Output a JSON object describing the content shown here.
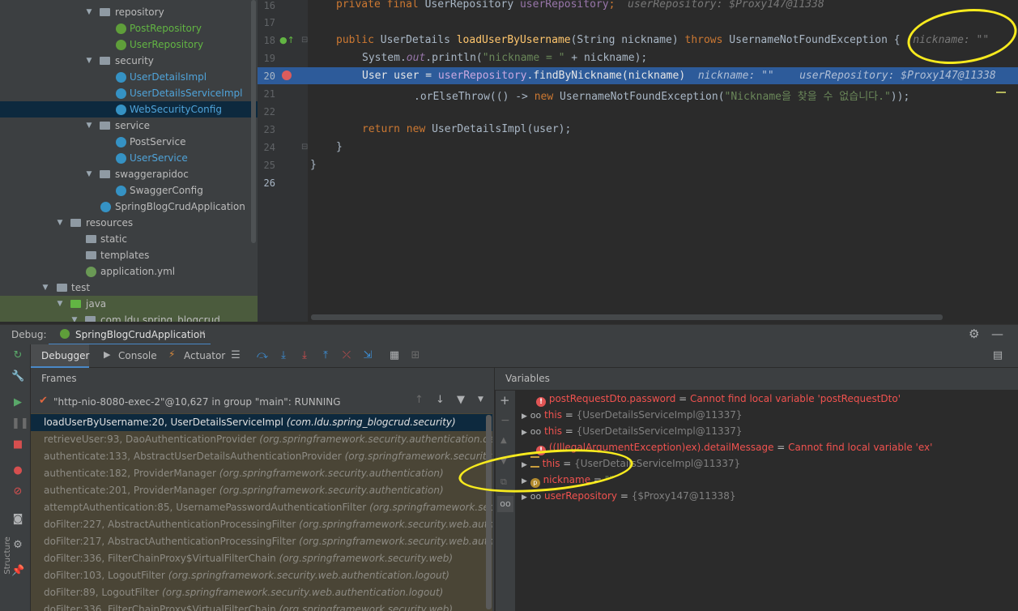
{
  "project_tree": {
    "items": [
      {
        "label": "repository",
        "kind": "folder",
        "expanded": true
      },
      {
        "label": "PostRepository",
        "kind": "interface"
      },
      {
        "label": "UserRepository",
        "kind": "interface"
      },
      {
        "label": "security",
        "kind": "folder",
        "expanded": true
      },
      {
        "label": "UserDetailsImpl",
        "kind": "class"
      },
      {
        "label": "UserDetailsServiceImpl",
        "kind": "class"
      },
      {
        "label": "WebSecurityConfig",
        "kind": "class"
      },
      {
        "label": "service",
        "kind": "folder",
        "expanded": true
      },
      {
        "label": "PostService",
        "kind": "class"
      },
      {
        "label": "UserService",
        "kind": "class"
      },
      {
        "label": "swaggerapidoc",
        "kind": "folder",
        "expanded": true
      },
      {
        "label": "SwaggerConfig",
        "kind": "class"
      },
      {
        "label": "SpringBlogCrudApplication",
        "kind": "app"
      },
      {
        "label": "resources",
        "kind": "folder",
        "expanded": true
      },
      {
        "label": "static",
        "kind": "folder"
      },
      {
        "label": "templates",
        "kind": "folder"
      },
      {
        "label": "application.yml",
        "kind": "yml"
      },
      {
        "label": "test",
        "kind": "folder",
        "expanded": true
      },
      {
        "label": "java",
        "kind": "folder",
        "expanded": true
      },
      {
        "label": "com.ldu.spring_blogcrud",
        "kind": "package"
      }
    ]
  },
  "editor": {
    "line_numbers": [
      "16",
      "17",
      "18",
      "19",
      "20",
      "21",
      "22",
      "23",
      "24",
      "25",
      "26"
    ],
    "lines": {
      "l16_kw": "private final ",
      "l16_type": "UserRepository ",
      "l16_field": "userRepository",
      "l16_semi": ";",
      "l16_hint": "userRepository: $Proxy147@11338",
      "l18_kw1": "public ",
      "l18_type": "UserDetails ",
      "l18_fn": "loadUserByUsername",
      "l18_params": "(String nickname) ",
      "l18_kw2": "throws ",
      "l18_exc": "UsernameNotFoundException {",
      "l18_hint": "nickname: \"\"",
      "l19_a": "System.",
      "l19_out": "out",
      "l19_b": ".println(",
      "l19_str": "\"nickname = \"",
      "l19_c": " + nickname);",
      "l20_a": "User user = ",
      "l20_field": "userRepository",
      "l20_b": ".findByNickname(nickname)",
      "l20_hint1": "nickname: \"\"",
      "l20_hint2": "userRepository: $Proxy147@11338",
      "l21_a": ".orElseThrow(() -> ",
      "l21_kw": "new ",
      "l21_b": "UsernameNotFoundException(",
      "l21_str": "\"Nickname을 찾을 수 없습니다.\"",
      "l21_c": "));",
      "l23_kw1": "return ",
      "l23_kw2": "new ",
      "l23_b": "UserDetailsImpl(user);",
      "l24": "}",
      "l25": "}"
    }
  },
  "debug": {
    "label": "Debug:",
    "run_config": "SpringBlogCrudApplication",
    "tabs": [
      "Debugger",
      "Console",
      "Actuator"
    ],
    "frames_title": "Frames",
    "variables_title": "Variables",
    "thread": "\"http-nio-8080-exec-2\"@10,627 in group \"main\": RUNNING",
    "frames": [
      {
        "method": "loadUserByUsername:20, UserDetailsServiceImpl",
        "pkg": "(com.ldu.spring_blogcrud.security)"
      },
      {
        "method": "retrieveUser:93, DaoAuthenticationProvider",
        "pkg": "(org.springframework.security.authentication.dao)"
      },
      {
        "method": "authenticate:133, AbstractUserDetailsAuthenticationProvider",
        "pkg": "(org.springframework.security.authentic"
      },
      {
        "method": "authenticate:182, ProviderManager",
        "pkg": "(org.springframework.security.authentication)"
      },
      {
        "method": "authenticate:201, ProviderManager",
        "pkg": "(org.springframework.security.authentication)"
      },
      {
        "method": "attemptAuthentication:85, UsernamePasswordAuthenticationFilter",
        "pkg": "(org.springframework.security.web.au"
      },
      {
        "method": "doFilter:227, AbstractAuthenticationProcessingFilter",
        "pkg": "(org.springframework.security.web.authentication)"
      },
      {
        "method": "doFilter:217, AbstractAuthenticationProcessingFilter",
        "pkg": "(org.springframework.security.web.authentication)"
      },
      {
        "method": "doFilter:336, FilterChainProxy$VirtualFilterChain",
        "pkg": "(org.springframework.security.web)"
      },
      {
        "method": "doFilter:103, LogoutFilter",
        "pkg": "(org.springframework.security.web.authentication.logout)"
      },
      {
        "method": "doFilter:89, LogoutFilter",
        "pkg": "(org.springframework.security.web.authentication.logout)"
      },
      {
        "method": "doFilter:336, FilterChainProxy$VirtualFilterChain",
        "pkg": "(org.springframework.security.web)"
      }
    ],
    "variables": [
      {
        "name": "postRequestDto.password",
        "eq": " = ",
        "value": "Cannot find local variable 'postRequestDto'",
        "type": "error"
      },
      {
        "name": "this",
        "eq": " = ",
        "value": "{UserDetailsServiceImpl@11337}",
        "type": "watch"
      },
      {
        "name": "this",
        "eq": " = ",
        "value": "{UserDetailsServiceImpl@11337}",
        "type": "watch"
      },
      {
        "name": "((IllegalArgumentException)ex).detailMessage",
        "eq": " = ",
        "value": "Cannot find local variable 'ex'",
        "type": "error"
      },
      {
        "name": "this",
        "eq": " = ",
        "value": "{UserDetailsServiceImpl@11337}",
        "type": "list"
      },
      {
        "name": "nickname",
        "eq": " = ",
        "value": "\"\"",
        "type": "param"
      },
      {
        "name": "userRepository",
        "eq": " = ",
        "value": "{$Proxy147@11338}",
        "type": "watch"
      }
    ]
  },
  "colors": {
    "highlight": "#f7ea1e",
    "exec_line": "#2d5b9a"
  }
}
